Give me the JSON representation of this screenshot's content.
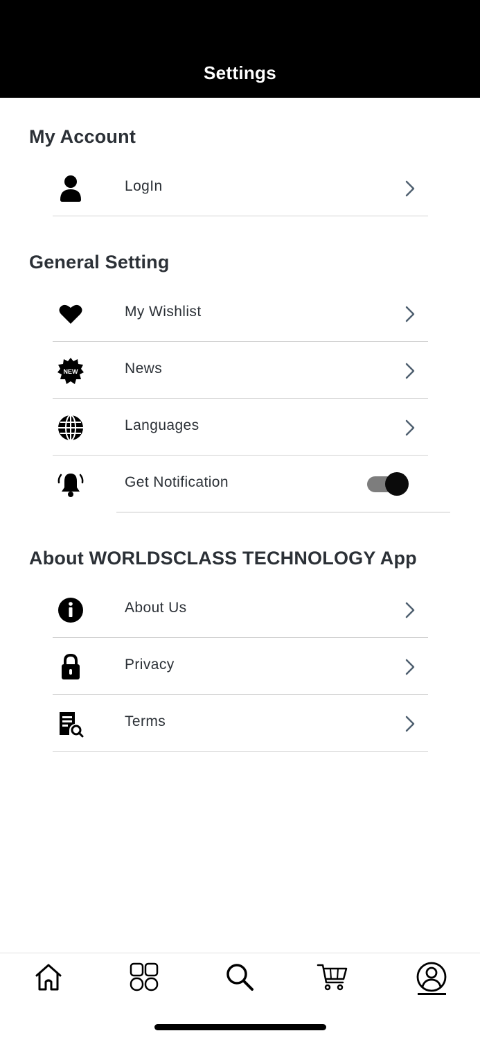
{
  "header": {
    "title": "Settings"
  },
  "sections": {
    "account": {
      "title": "My Account",
      "items": [
        {
          "label": "LogIn",
          "icon": "user-icon"
        }
      ]
    },
    "general": {
      "title": "General Setting",
      "items": [
        {
          "label": "My Wishlist",
          "icon": "heart-icon"
        },
        {
          "label": "News",
          "icon": "new-badge-icon",
          "badge_text": "NEW"
        },
        {
          "label": "Languages",
          "icon": "globe-icon"
        },
        {
          "label": "Get Notification",
          "icon": "bell-icon",
          "toggle_on": true
        }
      ]
    },
    "about": {
      "title": "About WORLDSCLASS TECHNOLOGY App",
      "items": [
        {
          "label": "About Us",
          "icon": "info-icon"
        },
        {
          "label": "Privacy",
          "icon": "lock-icon"
        },
        {
          "label": "Terms",
          "icon": "document-search-icon"
        }
      ]
    }
  },
  "tabbar": {
    "tabs": [
      {
        "name": "home",
        "icon": "home-icon"
      },
      {
        "name": "categories",
        "icon": "grid-icon"
      },
      {
        "name": "search",
        "icon": "search-icon"
      },
      {
        "name": "cart",
        "icon": "cart-icon"
      },
      {
        "name": "account",
        "icon": "profile-icon",
        "active": true
      }
    ]
  },
  "colors": {
    "header_bg": "#000000",
    "text": "#2b3036",
    "chevron": "#4f6070",
    "separator": "#d2d2d2",
    "toggle_track": "#7d7d7d",
    "toggle_knob": "#0b0b0b"
  }
}
